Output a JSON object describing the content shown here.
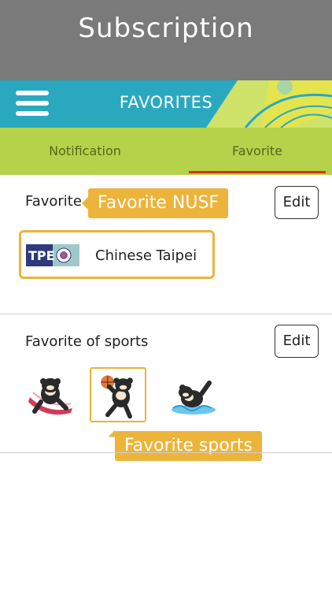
{
  "banner": {
    "title": "Subscription"
  },
  "header": {
    "title": "FAVORITES",
    "menu_icon": "hamburger-menu-icon",
    "accent": "#2aa8c0"
  },
  "tabs": [
    {
      "label": "Notification",
      "active": false
    },
    {
      "label": "Favorite",
      "active": true
    }
  ],
  "nusf_section": {
    "title": "Favorite",
    "edit_label": "Edit",
    "tooltip": "Favorite NUSF",
    "teams": [
      {
        "code": "TPE",
        "name": "Chinese Taipei"
      }
    ]
  },
  "sports_section": {
    "title": "Favorite of sports",
    "edit_label": "Edit",
    "tooltip": "Favorite sports",
    "items": [
      {
        "icon": "athletics-mascot-icon",
        "selected": false
      },
      {
        "icon": "basketball-mascot-icon",
        "selected": true
      },
      {
        "icon": "swimming-mascot-icon",
        "selected": false
      }
    ]
  },
  "colors": {
    "tab_bar": "#b5d24a",
    "tab_underline": "#d4331c",
    "highlight": "#ecb43a",
    "banner": "#7a7a7a"
  }
}
